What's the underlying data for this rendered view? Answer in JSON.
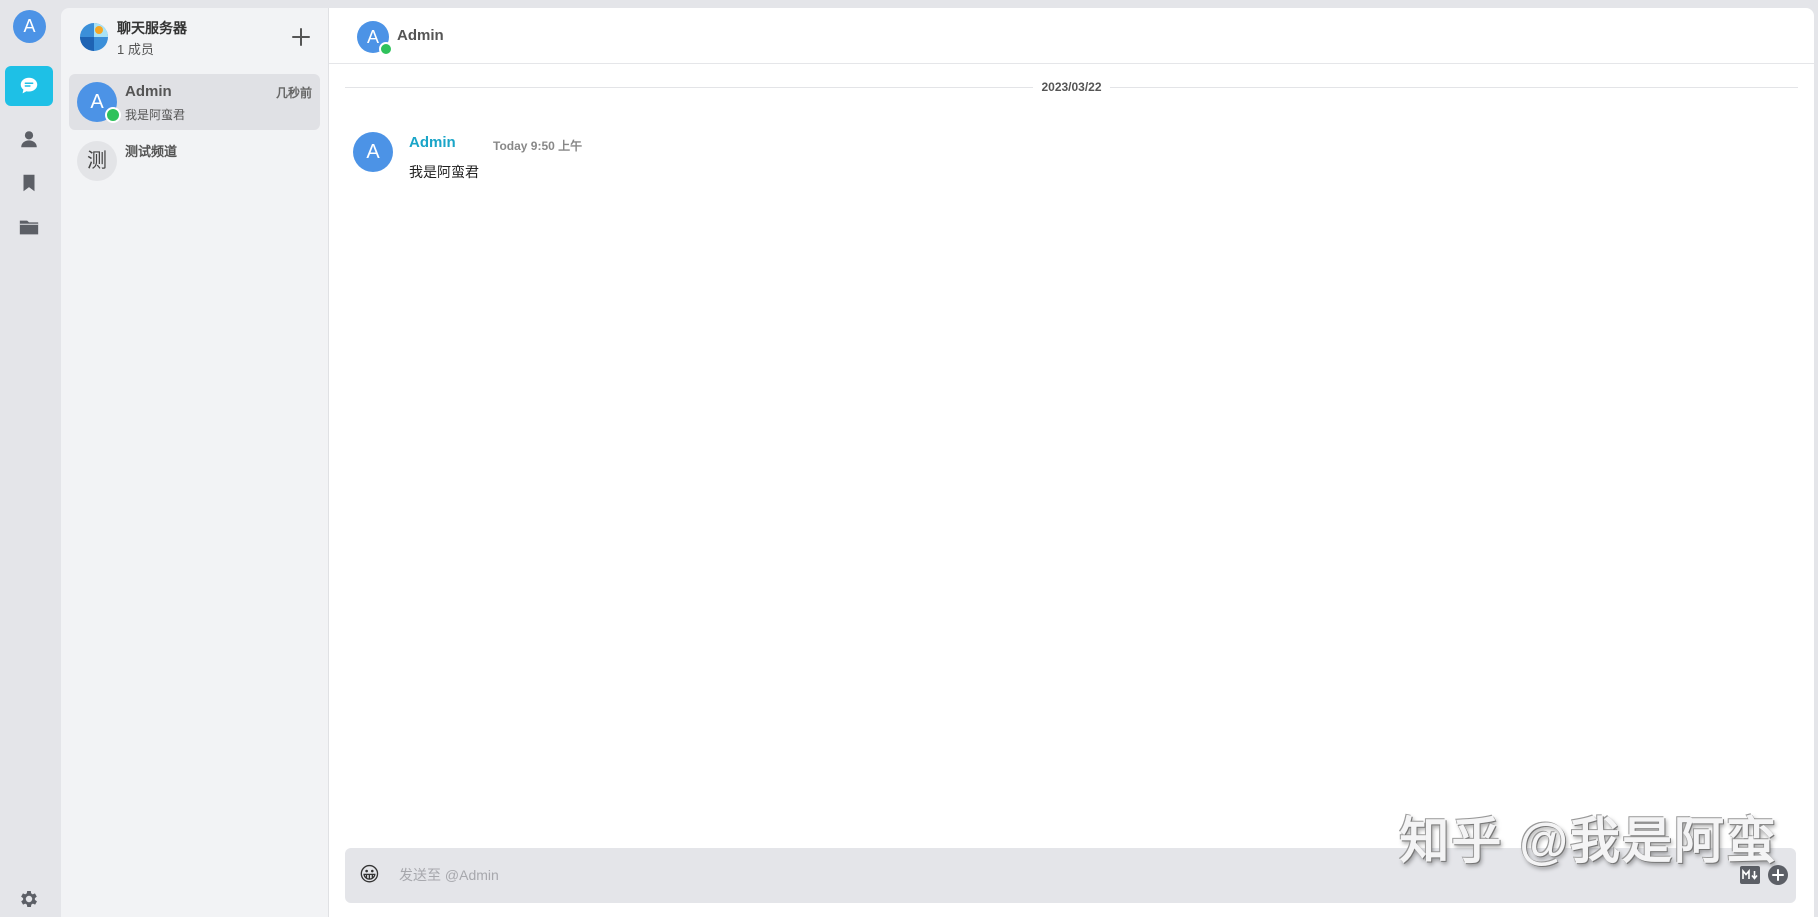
{
  "rail": {
    "user_avatar": "A",
    "items": [
      {
        "icon": "chat-bubble-icon",
        "active": true
      },
      {
        "icon": "user-icon",
        "active": false
      },
      {
        "icon": "bookmark-icon",
        "active": false
      },
      {
        "icon": "folder-icon",
        "active": false
      }
    ],
    "settings_icon": "gear-icon"
  },
  "server": {
    "name": "聊天服务器",
    "members": "1 成员"
  },
  "conversations": [
    {
      "avatar": "A",
      "name": "Admin",
      "time": "几秒前",
      "last_message": "我是阿蛮君",
      "online": true,
      "active": true
    },
    {
      "avatar": "测",
      "name": "测试频道",
      "active": false
    }
  ],
  "chat": {
    "header": {
      "avatar": "A",
      "name": "Admin"
    },
    "date_divider": "2023/03/22",
    "messages": [
      {
        "avatar": "A",
        "author": "Admin",
        "time": "Today 9:50 上午",
        "text": "我是阿蛮君"
      }
    ],
    "composer": {
      "placeholder": "发送至 @Admin",
      "emoji": "😀"
    }
  },
  "watermark": "知乎 @我是阿蛮",
  "colors": {
    "accent": "#1ec0e6",
    "avatar_blue": "#4c93e6",
    "online": "#2fc25b",
    "author": "#1aa5c8"
  }
}
